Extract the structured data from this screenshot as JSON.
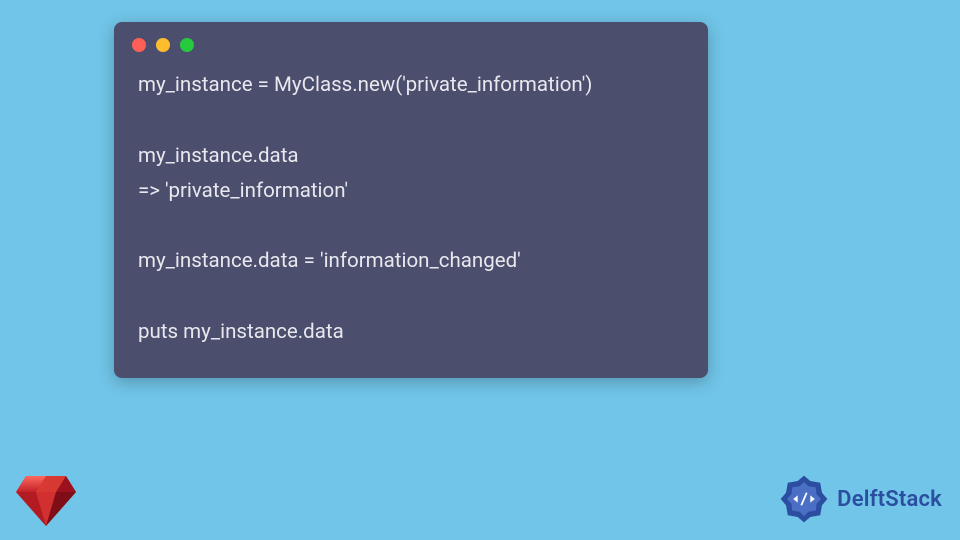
{
  "code": {
    "lines": [
      "my_instance = MyClass.new('private_information')",
      "",
      "my_instance.data",
      "=> 'private_information'",
      "",
      "my_instance.data = 'information_changed'",
      "",
      "puts my_instance.data"
    ]
  },
  "brand": {
    "name": "DelftStack"
  },
  "icons": {
    "ruby": "ruby-gem-icon",
    "delft": "delft-badge-icon"
  },
  "window": {
    "dots": [
      "red",
      "yellow",
      "green"
    ]
  }
}
